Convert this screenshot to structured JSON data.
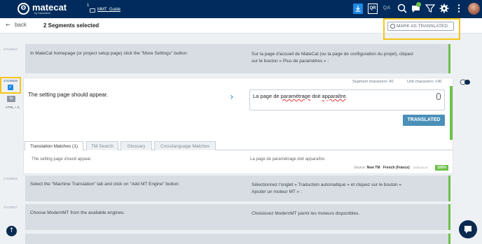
{
  "topbar": {
    "logo_text": "matecat",
    "logo_sub": "by translated",
    "project_number": "1",
    "project_name": "MMT_Guide",
    "qr_label": "QR",
    "qa_label": "QA",
    "notification_count": ""
  },
  "subheader": {
    "back_label": "back",
    "selected_label": "2 Segments selected",
    "mark_button_label": "MARK AS TRANSLATED"
  },
  "segments": [
    {
      "id": "27449524",
      "source": "In MateCat homepage (or project setup page) click the \"More Settings\" button:",
      "target_lines": [
        "Sur la page d'accueil de MateCat (ou la page de configuration du projet), cliquez",
        "sur le bouton « Plus de paramètres » :"
      ]
    },
    {
      "id": "27449526",
      "source": "Select the \"Machine Translation\" tab and click on \"Add MT Engine\" button:",
      "target_lines": [
        "Sélectionnez l'onglet « Traduction automatique » et cliquez sur le bouton «",
        "Ajouter un moteur MT » :"
      ]
    },
    {
      "id": "27449527",
      "source": "Choose ModernMT from the available engines.",
      "target_lines": [
        "Choisissez ModernMT parmi les moteurs disponibles."
      ]
    }
  ],
  "active": {
    "id": "27449525",
    "ctrl_label": "CTRL + S",
    "segment_chars_label": "Segment characters: 40",
    "unit_chars_label": "Unit characters: 140",
    "source": "The setting page should appear.",
    "target_pre": "La page de ",
    "target_word1": "paramétrage",
    "target_mid": " doit ",
    "target_word2": "apparaître",
    "target_post": ".",
    "translated_button": "TRANSLATED",
    "tabs": [
      "Translation Matches (1)",
      "TM Search",
      "Glossary",
      "Crosslanguage Matches"
    ],
    "match": {
      "source": "The setting page should appear.",
      "target": "La page de paramétrage doit apparaître.",
      "source_label": "Source:",
      "source_value": "New TM",
      "language": "French (France)",
      "date": "2025-03-24",
      "percent": "100%"
    }
  },
  "colors": {
    "topbar": "#002b5c",
    "accent": "#1e88e5",
    "status_green": "#6cc04a",
    "highlight": "#f5c518",
    "translated_button": "#4a90b8"
  }
}
